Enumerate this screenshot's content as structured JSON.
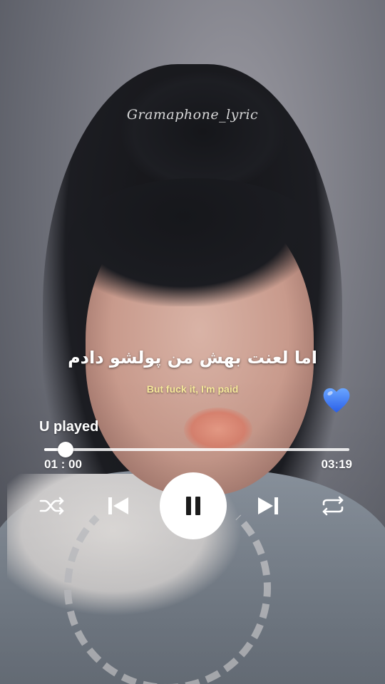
{
  "watermark": "Gramaphone_lyric",
  "lyrics": {
    "persian": "اما لعنت بهش من پولشو دادم",
    "english": "But fuck it, I'm paid"
  },
  "reaction_icon": "blue-heart-icon",
  "player": {
    "status_label": "U played",
    "elapsed": "01 : 00",
    "total": "03:19",
    "progress_fraction": 0.07,
    "controls": {
      "shuffle": "shuffle-icon",
      "previous": "skip-previous-icon",
      "play_pause": "pause-icon",
      "next": "skip-next-icon",
      "repeat": "repeat-icon"
    }
  },
  "colors": {
    "accent_heart": "#3d7bff",
    "lyric_translation": "#f6e89a",
    "controls": "#ffffff"
  }
}
